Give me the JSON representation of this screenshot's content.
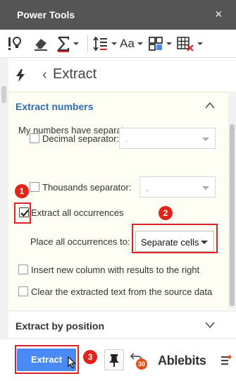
{
  "window": {
    "title": "Power Tools",
    "close_symbol": "×"
  },
  "toolbar": {
    "icons": [
      "question-light-icon",
      "eraser-icon",
      "sigma-icon",
      "line-spacing-icon",
      "text-case-icon",
      "layout-grid-icon",
      "delete-grid-icon"
    ],
    "text_case_label": "Aa"
  },
  "nav": {
    "back_symbol": "‹",
    "title": "Extract"
  },
  "section": {
    "title": "Extract numbers",
    "separators_label": "My numbers have separators",
    "decimal": {
      "label": "Decimal separator:",
      "value": ".",
      "checked": false
    },
    "thousands": {
      "label": "Thousands separator:",
      "value": ",",
      "checked": false
    },
    "extract_all": {
      "label": "Extract all occurrences",
      "checked": true
    },
    "place_label": "Place all occurrences to:",
    "place_value": "Separate cells",
    "insert_column": {
      "label": "Insert new column with results to the right",
      "checked": false
    },
    "clear_source": {
      "label": "Clear the extracted text from the source data",
      "checked": false
    }
  },
  "collapsed_section": {
    "title": "Extract by position"
  },
  "footer": {
    "extract_label": "Extract",
    "undo_count": "30",
    "brand": "Ablebits"
  },
  "callouts": [
    "1",
    "2",
    "3"
  ],
  "colors": {
    "accent_blue": "#4a8af4",
    "callout_red": "#e2231a",
    "title_bar": "#555555",
    "section_title": "#2e6db4"
  }
}
